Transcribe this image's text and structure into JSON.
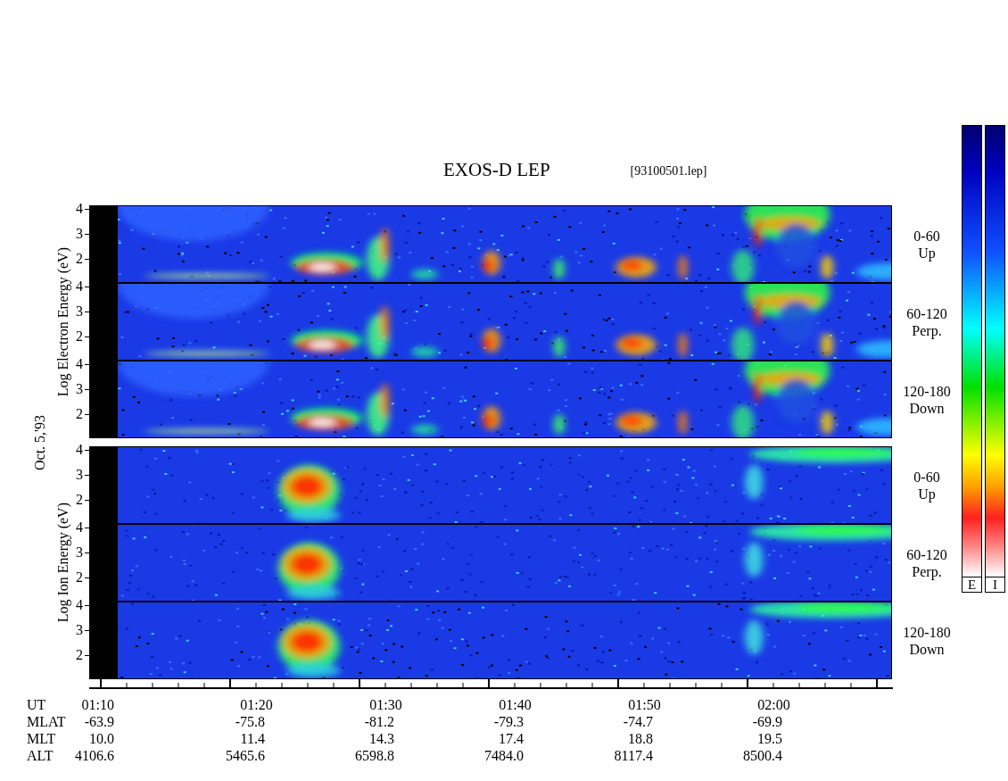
{
  "title": "EXOS-D LEP",
  "file": "[93100501.lep]",
  "date": "Oct. 5,'93",
  "groups": [
    {
      "kind": "electron",
      "axis_label": "Log Electron Energy (eV)",
      "panels": [
        {
          "ticks": [
            "4",
            "3",
            "2"
          ],
          "angle": "0-60",
          "direction": "Up"
        },
        {
          "ticks": [
            "4",
            "3",
            "2"
          ],
          "angle": "60-120",
          "direction": "Perp."
        },
        {
          "ticks": [
            "4",
            "3",
            "2"
          ],
          "angle": "120-180",
          "direction": "Down"
        }
      ]
    },
    {
      "kind": "ion",
      "axis_label": "Log Ion Energy (eV)",
      "panels": [
        {
          "ticks": [
            "4",
            "3",
            "2"
          ],
          "angle": "0-60",
          "direction": "Up"
        },
        {
          "ticks": [
            "4",
            "3",
            "2"
          ],
          "angle": "60-120",
          "direction": "Perp."
        },
        {
          "ticks": [
            "4",
            "3",
            "2"
          ],
          "angle": "120-180",
          "direction": "Down"
        }
      ]
    }
  ],
  "time_table": [
    {
      "label": "UT",
      "values": [
        "01:10",
        "01:20",
        "01:30",
        "01:40",
        "01:50",
        "02:00"
      ]
    },
    {
      "label": "MLAT",
      "values": [
        "-63.9",
        "-75.8",
        "-81.2",
        "-79.3",
        "-74.7",
        "-69.9"
      ]
    },
    {
      "label": "MLT",
      "values": [
        "10.0",
        "11.4",
        "14.3",
        "17.4",
        "18.8",
        "19.5"
      ]
    },
    {
      "label": "ALT",
      "values": [
        "4106.6",
        "5465.6",
        "6598.8",
        "7484.0",
        "8117.4",
        "8500.4"
      ]
    }
  ],
  "colorbars": [
    {
      "label": "E"
    },
    {
      "label": "I"
    }
  ]
}
